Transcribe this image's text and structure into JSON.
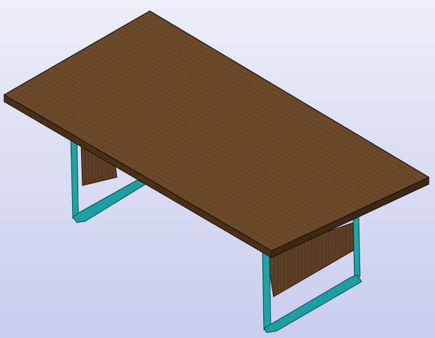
{
  "viewport": {
    "background_top": "#eceef8",
    "background_bottom": "#c9cdee"
  },
  "model": {
    "object": "table",
    "view": "isometric",
    "colors": {
      "tabletop_top": "#6b4a2a",
      "tabletop_edge": "#4a3019",
      "panel": "#5a3d22",
      "frame": "#1aa6a6",
      "frame_dark": "#0b6e72",
      "outline": "#1a1208"
    }
  }
}
